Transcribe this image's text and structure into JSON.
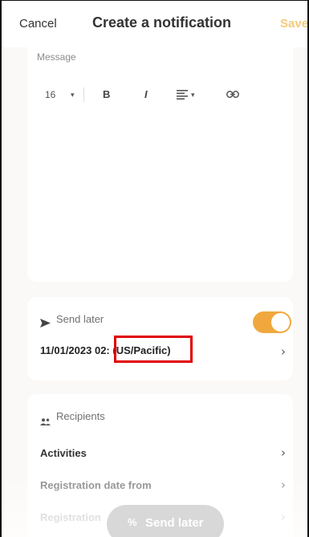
{
  "header": {
    "cancel_label": "Cancel",
    "title": "Create a notification",
    "save_label": "Save"
  },
  "message": {
    "label": "Message",
    "toolbar": {
      "font_size": "16",
      "bold": "B",
      "italic": "I",
      "caret": "▾"
    }
  },
  "send_later": {
    "label": "Send later",
    "enabled": true,
    "datetime": "11/01/2023 02:",
    "timezone": "(US/Pacific)"
  },
  "recipients": {
    "label": "Recipients",
    "rows": [
      {
        "label": "Activities"
      },
      {
        "label": "Registration date from"
      },
      {
        "label": "Registration"
      }
    ]
  },
  "fab": {
    "label": "Send later",
    "icon": "%"
  },
  "colors": {
    "accent": "#f0a83e",
    "save_disabled": "#f5c97a",
    "highlight": "#e00000"
  },
  "icons": {
    "chevron": "›"
  }
}
